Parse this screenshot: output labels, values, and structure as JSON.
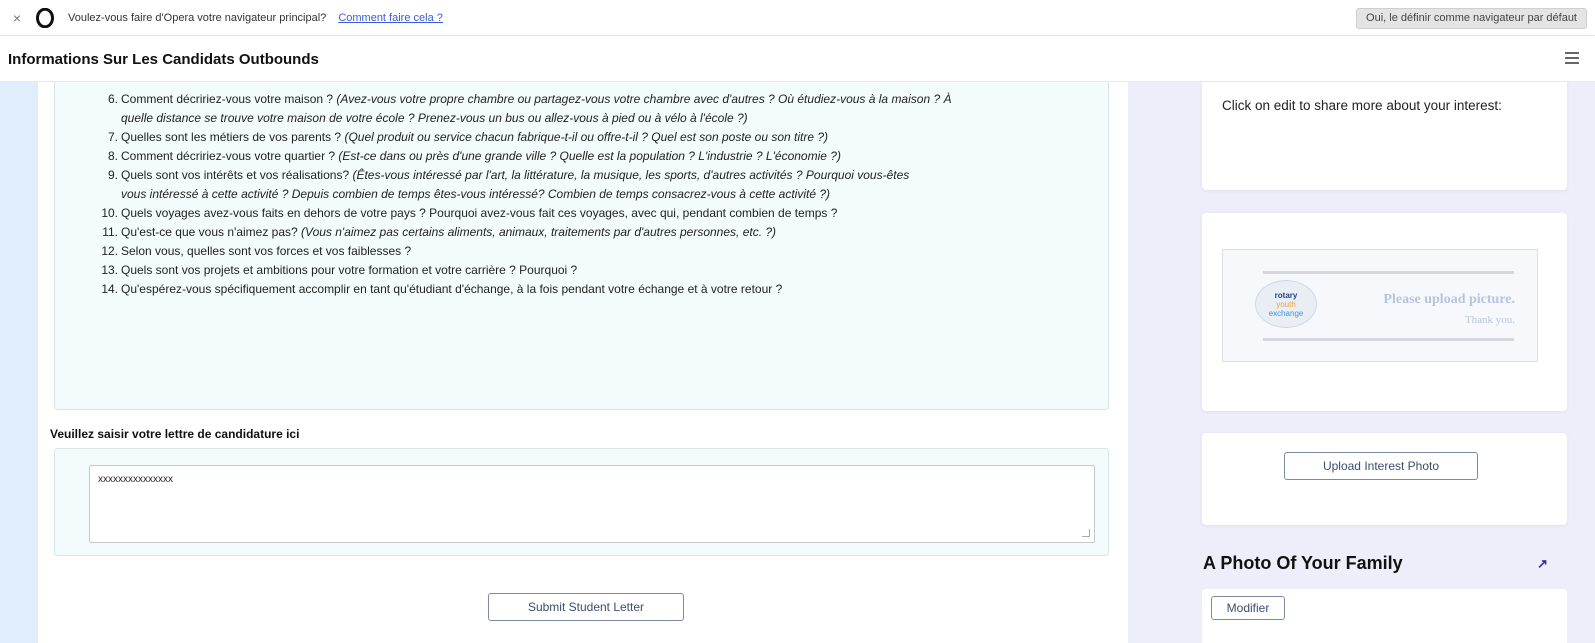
{
  "opera_bar": {
    "close_glyph": "×",
    "message": "Voulez-vous faire d'Opera votre navigateur principal?",
    "link": "Comment faire cela ?",
    "default_button": "Oui, le définir comme navigateur par défaut"
  },
  "header": {
    "title": "Informations Sur Les Candidats Outbounds",
    "menu_icon": "hamburger-menu-icon"
  },
  "questions": [
    {
      "num": "6.",
      "text": "Comment décririez-vous votre maison ? ",
      "italic": "(Avez-vous votre propre chambre ou partagez-vous votre chambre avec d'autres ? Où étudiez-vous à la maison ? À",
      "continuation": "quelle distance se trouve votre maison de votre école ? Prenez-vous un bus ou allez-vous à pied ou à vélo à l'école ?)"
    },
    {
      "num": "7.",
      "text": "Quelles sont les métiers de vos parents ? ",
      "italic": "(Quel produit ou service chacun fabrique-t-il ou offre-t-il ? Quel est son poste ou son titre ?)"
    },
    {
      "num": "8.",
      "text": "Comment décririez-vous votre quartier ? ",
      "italic": "(Est-ce dans ou près d'une grande ville ? Quelle est la population ? L'industrie ? L'économie ?)"
    },
    {
      "num": "9.",
      "text": "Quels sont vos intérêts et vos réalisations? ",
      "italic": "(Êtes-vous intéressé par l'art, la littérature, la musique, les sports, d'autres activités ? Pourquoi vous-êtes",
      "continuation": "vous intéressé à cette activité ? Depuis combien de temps êtes-vous intéressé? Combien de temps consacrez-vous à cette activité ?)"
    },
    {
      "num": "10.",
      "text": "Quels voyages avez-vous faits en dehors de votre pays ? Pourquoi avez-vous fait ces voyages, avec qui, pendant combien de temps ?",
      "italic": ""
    },
    {
      "num": "11.",
      "text": "Qu'est-ce que vous n'aimez pas? ",
      "italic": "(Vous n'aimez pas certains aliments, animaux, traitements par d'autres personnes, etc. ?)"
    },
    {
      "num": "12.",
      "text": "Selon vous, quelles sont vos forces et vos faiblesses ?",
      "italic": ""
    },
    {
      "num": "13.",
      "text": "Quels sont vos projets et ambitions pour votre formation et votre carrière ? Pourquoi ?",
      "italic": ""
    },
    {
      "num": "14.",
      "text": "Qu'espérez-vous spécifiquement accomplir en tant qu'étudiant d'échange, à la fois pendant votre échange et à votre retour ?",
      "italic": ""
    }
  ],
  "letter": {
    "label": "Veuillez saisir votre lettre de candidature ici",
    "value": "xxxxxxxxxxxxxxx",
    "submit": "Submit Student Letter"
  },
  "interest": {
    "prompt": "Click on edit to share more about your interest:",
    "placeholder_logo": [
      "rotary",
      "youth",
      "exchange"
    ],
    "placeholder_line1": "Please upload picture.",
    "placeholder_line2": "Thank you.",
    "upload_button": "Upload Interest Photo"
  },
  "family": {
    "heading": "A Photo Of Your Family",
    "arrow_glyph": "↗",
    "modify_button": "Modifier"
  },
  "colors": {
    "panel_bg": "#f3fbfc",
    "right_bg": "#eeedfa",
    "gutter_bg": "#dfeefa",
    "link": "#3b5cd9"
  }
}
